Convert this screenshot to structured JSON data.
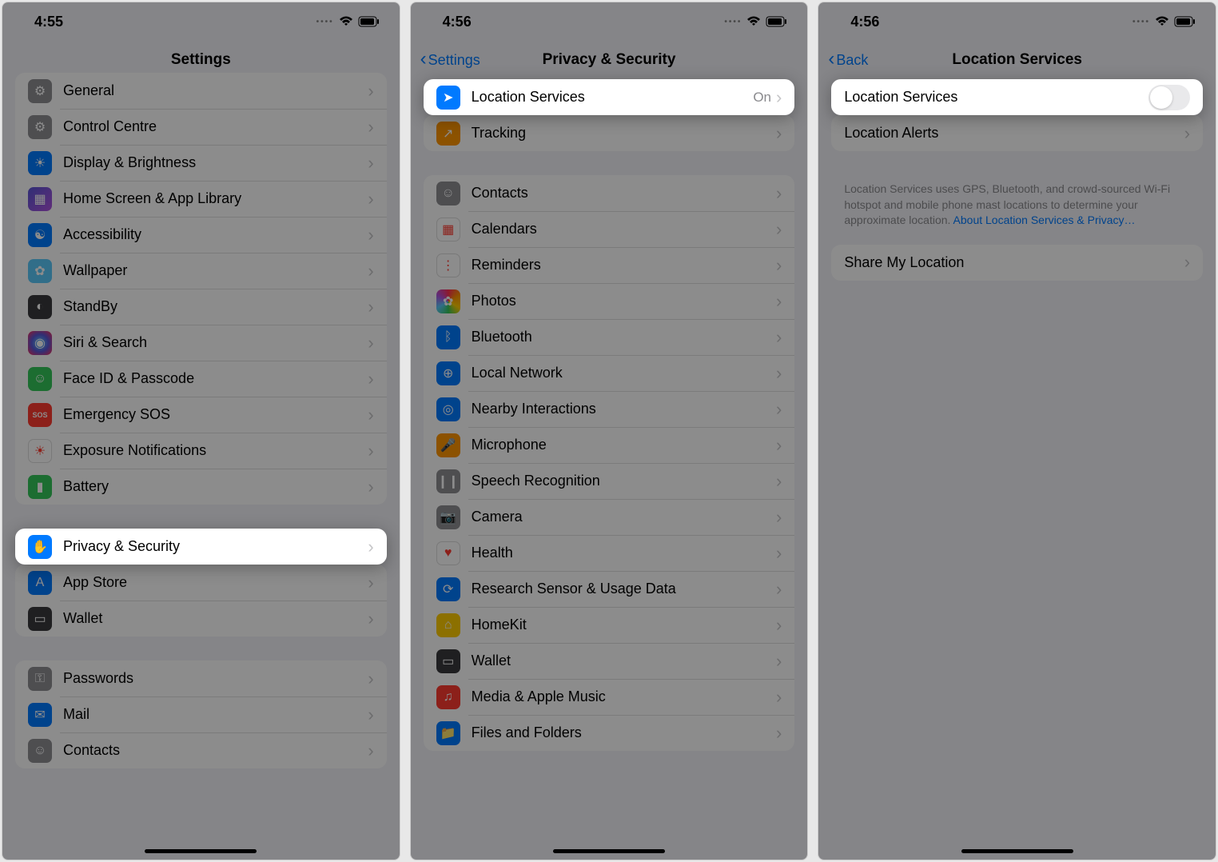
{
  "screens": [
    {
      "status_time": "4:55",
      "nav_title": "Settings",
      "back_label": null,
      "groups": [
        [
          {
            "label": "General",
            "icon": "gear-icon",
            "bg": "ic-gray"
          },
          {
            "label": "Control Centre",
            "icon": "sliders-icon",
            "bg": "ic-gray"
          },
          {
            "label": "Display & Brightness",
            "icon": "brightness-icon",
            "bg": "ic-blue"
          },
          {
            "label": "Home Screen & App Library",
            "icon": "grid-icon",
            "bg": "ic-purple"
          },
          {
            "label": "Accessibility",
            "icon": "accessibility-icon",
            "bg": "ic-blue"
          },
          {
            "label": "Wallpaper",
            "icon": "flower-icon",
            "bg": "ic-teal"
          },
          {
            "label": "StandBy",
            "icon": "clock-icon",
            "bg": "ic-dkgray"
          },
          {
            "label": "Siri & Search",
            "icon": "siri-icon",
            "bg": "ic-siri"
          },
          {
            "label": "Face ID & Passcode",
            "icon": "faceid-icon",
            "bg": "ic-green"
          },
          {
            "label": "Emergency SOS",
            "icon": "sos-icon",
            "bg": "ic-red"
          },
          {
            "label": "Exposure Notifications",
            "icon": "exposure-icon",
            "bg": "ic-white"
          },
          {
            "label": "Battery",
            "icon": "battery-icon",
            "bg": "ic-green"
          },
          {
            "label": "Privacy & Security",
            "icon": "hand-icon",
            "bg": "ic-blue",
            "highlight": true
          }
        ],
        [
          {
            "label": "App Store",
            "icon": "appstore-icon",
            "bg": "ic-blue"
          },
          {
            "label": "Wallet",
            "icon": "wallet-icon",
            "bg": "ic-dkgray"
          }
        ],
        [
          {
            "label": "Passwords",
            "icon": "key-icon",
            "bg": "ic-gray"
          },
          {
            "label": "Mail",
            "icon": "mail-icon",
            "bg": "ic-blue"
          },
          {
            "label": "Contacts",
            "icon": "contacts-icon",
            "bg": "ic-gray"
          }
        ]
      ]
    },
    {
      "status_time": "4:56",
      "nav_title": "Privacy & Security",
      "back_label": "Settings",
      "groups": [
        [
          {
            "label": "Location Services",
            "icon": "location-icon",
            "bg": "ic-blue",
            "value": "On",
            "highlight": true
          },
          {
            "label": "Tracking",
            "icon": "tracking-icon",
            "bg": "ic-orange"
          }
        ],
        [
          {
            "label": "Contacts",
            "icon": "contacts-icon",
            "bg": "ic-gray"
          },
          {
            "label": "Calendars",
            "icon": "calendar-icon",
            "bg": "ic-white"
          },
          {
            "label": "Reminders",
            "icon": "reminders-icon",
            "bg": "ic-white"
          },
          {
            "label": "Photos",
            "icon": "photos-icon",
            "bg": "ic-multi"
          },
          {
            "label": "Bluetooth",
            "icon": "bluetooth-icon",
            "bg": "ic-blue"
          },
          {
            "label": "Local Network",
            "icon": "network-icon",
            "bg": "ic-blue"
          },
          {
            "label": "Nearby Interactions",
            "icon": "nearby-icon",
            "bg": "ic-blue"
          },
          {
            "label": "Microphone",
            "icon": "microphone-icon",
            "bg": "ic-orange"
          },
          {
            "label": "Speech Recognition",
            "icon": "speech-icon",
            "bg": "ic-gray"
          },
          {
            "label": "Camera",
            "icon": "camera-icon",
            "bg": "ic-gray"
          },
          {
            "label": "Health",
            "icon": "health-icon",
            "bg": "ic-white"
          },
          {
            "label": "Research Sensor & Usage Data",
            "icon": "research-icon",
            "bg": "ic-blue"
          },
          {
            "label": "HomeKit",
            "icon": "home-icon",
            "bg": "ic-yellow"
          },
          {
            "label": "Wallet",
            "icon": "wallet-icon",
            "bg": "ic-dkgray"
          },
          {
            "label": "Media & Apple Music",
            "icon": "music-icon",
            "bg": "ic-red"
          },
          {
            "label": "Files and Folders",
            "icon": "files-icon",
            "bg": "ic-blue"
          }
        ]
      ]
    },
    {
      "status_time": "4:56",
      "nav_title": "Location Services",
      "back_label": "Back",
      "groups": [
        [
          {
            "label": "Location Services",
            "toggle": true,
            "highlight": true,
            "no_icon": true
          },
          {
            "label": "Location Alerts",
            "no_icon": true
          }
        ]
      ],
      "footer_text": "Location Services uses GPS, Bluetooth, and crowd-sourced Wi-Fi hotspot and mobile phone mast locations to determine your approximate location. ",
      "footer_link": "About Location Services & Privacy…",
      "groups2": [
        [
          {
            "label": "Share My Location",
            "no_icon": true
          }
        ]
      ]
    }
  ],
  "chevron": "›",
  "back_chevron": "‹"
}
